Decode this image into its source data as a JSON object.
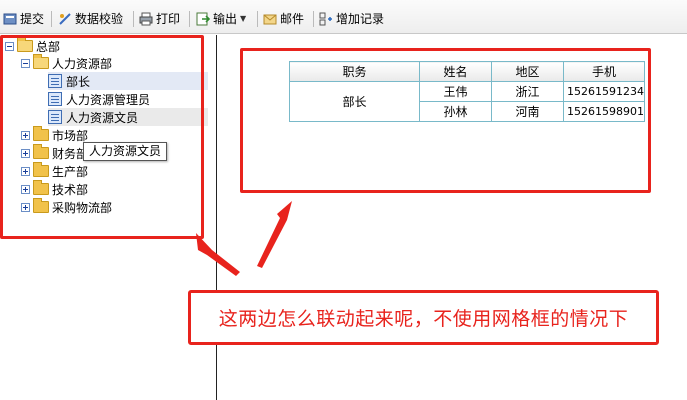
{
  "toolbar": {
    "submit": "提交",
    "validate": "数据校验",
    "print": "打印",
    "export": "输出",
    "mail": "邮件",
    "add_record": "增加记录"
  },
  "tree": {
    "root": "总部",
    "hr": "人力资源部",
    "hr_children": [
      "部长",
      "人力资源管理员",
      "人力资源文员"
    ],
    "market": "市场部",
    "finance": "财务部",
    "production": "生产部",
    "tech": "技术部",
    "procurement": "采购物流部"
  },
  "tooltip": "人力资源文员",
  "table": {
    "headers": [
      "职务",
      "姓名",
      "地区",
      "手机"
    ],
    "position": "部长",
    "rows": [
      {
        "name": "王伟",
        "region": "浙江",
        "phone": "15261591234"
      },
      {
        "name": "孙林",
        "region": "河南",
        "phone": "15261598901"
      }
    ]
  },
  "annotation": "这两边怎么联动起来呢，不使用网格框的情况下",
  "colors": {
    "highlight": "#e8231d",
    "grid_border": "#79b9c9"
  }
}
